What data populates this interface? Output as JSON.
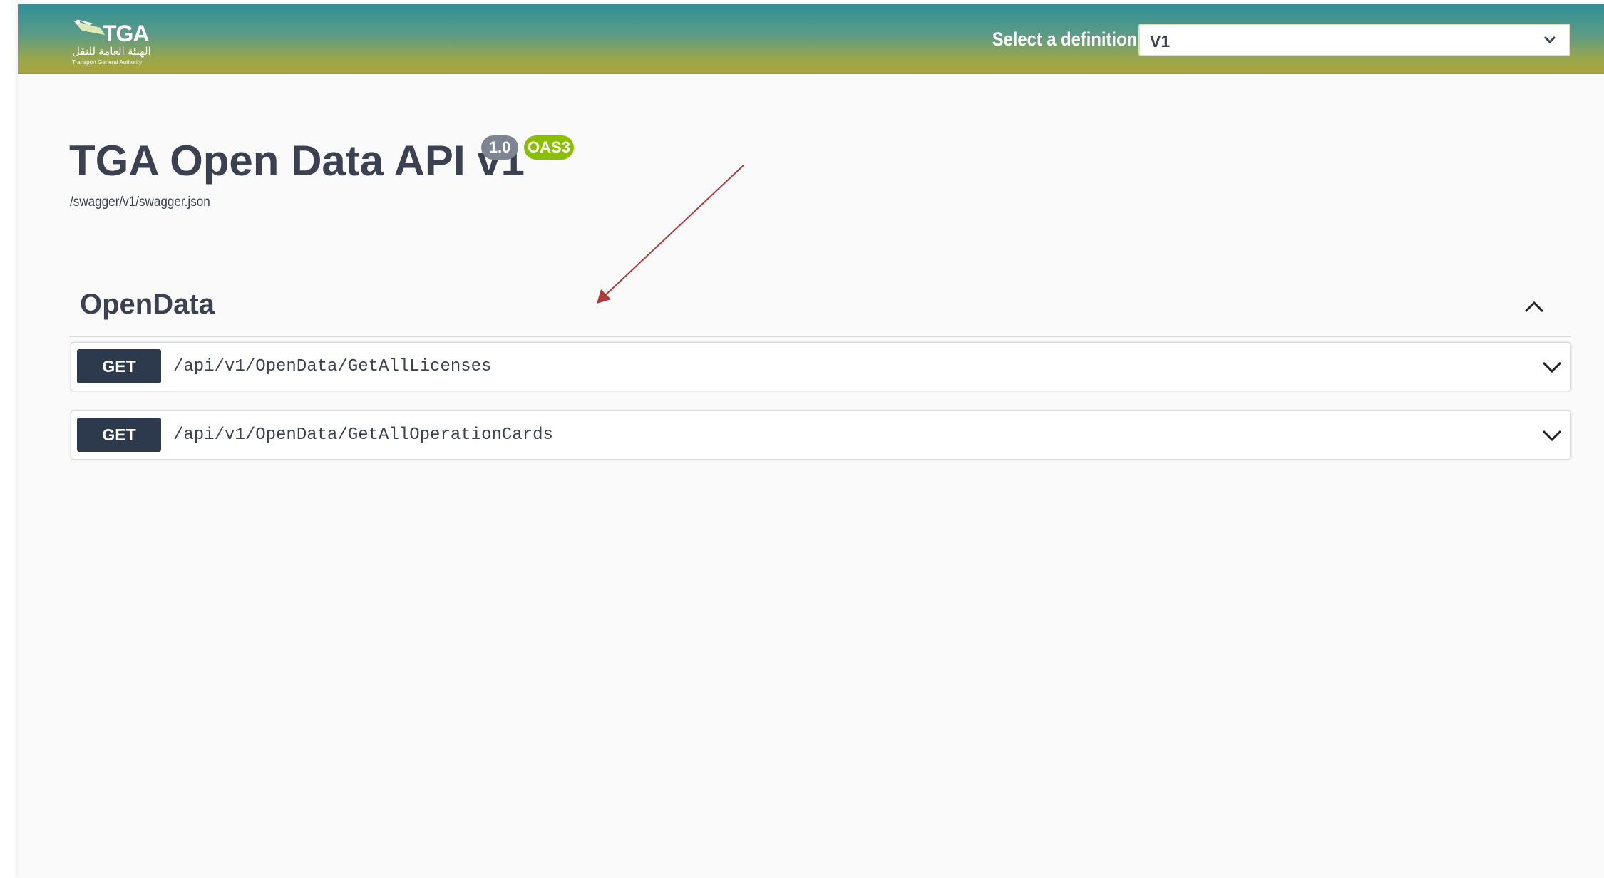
{
  "header": {
    "logo": {
      "title": "TGA",
      "arabic": "الهيئة العامة للنقل",
      "english": "Transport General Authority"
    },
    "definition_label": "Select a definition",
    "definition_value": "V1"
  },
  "info": {
    "title": "TGA Open Data API v1",
    "version_badge": "1.0",
    "oas_badge": "OAS3",
    "spec_url": "/swagger/v1/swagger.json"
  },
  "tag": {
    "name": "OpenData",
    "expanded": true
  },
  "operations": [
    {
      "method": "GET",
      "path": "/api/v1/OpenData/GetAllLicenses"
    },
    {
      "method": "GET",
      "path": "/api/v1/OpenData/GetAllOperationCards"
    }
  ],
  "colors": {
    "header_top": "#2f8f97",
    "header_bottom": "#a6a53e",
    "get_method": "#2d3a4d",
    "version_badge": "#7d8492",
    "oas_badge": "#89bf04",
    "text": "#3b4151",
    "annotation_arrow": "#b03a3a"
  },
  "icons": {
    "select_chevron": "chevron-down-icon",
    "tag_toggle": "chevron-up-icon",
    "operation_toggle": "chevron-down-icon",
    "annotation": "arrow-annotation-icon"
  }
}
